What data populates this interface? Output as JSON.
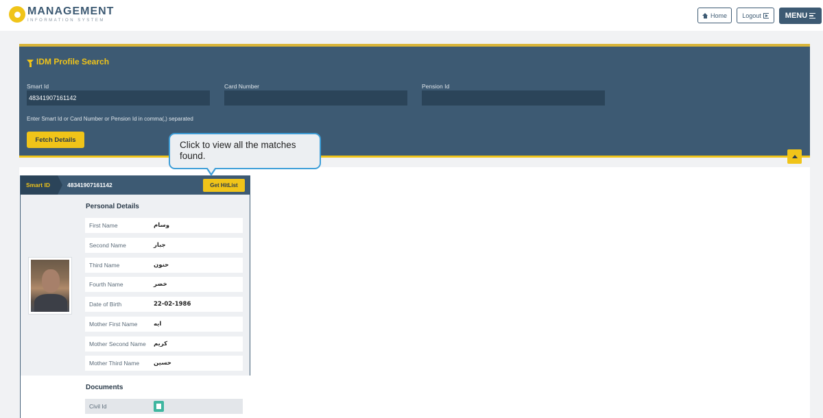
{
  "header": {
    "logo_title": "MANAGEMENT",
    "logo_subtitle": "INFORMATION SYSTEM",
    "home_label": "Home",
    "logout_label": "Logout",
    "menu_label": "MENU"
  },
  "search": {
    "title": "IDM Profile Search",
    "smart_id_label": "Smart Id",
    "smart_id_value": "48341907161142",
    "card_number_label": "Card Number",
    "card_number_value": "",
    "pension_id_label": "Pension Id",
    "pension_id_value": "",
    "hint": "Enter Smart Id or Card Number or Pension Id in comma(,) separated",
    "fetch_label": "Fetch Details"
  },
  "tooltip": {
    "text": "Click to view all the matches found."
  },
  "profile": {
    "smart_id_tag": "Smart ID",
    "smart_id_value": "48341907161142",
    "hitlist_label": "Get HitList",
    "personal_title": "Personal Details",
    "fields": [
      {
        "label": "First Name",
        "value": "وسام"
      },
      {
        "label": "Second Name",
        "value": "جبار"
      },
      {
        "label": "Third Name",
        "value": "حنون"
      },
      {
        "label": "Fourth Name",
        "value": "خضر"
      },
      {
        "label": "Date of Birth",
        "value": "22-02-1986"
      },
      {
        "label": "Mother First Name",
        "value": "ايه"
      },
      {
        "label": "Mother Second Name",
        "value": "كريم"
      },
      {
        "label": "Mother Third Name",
        "value": "حسين"
      }
    ],
    "documents_title": "Documents",
    "documents": [
      {
        "label": "Civil Id"
      }
    ]
  },
  "colors": {
    "primary": "#3d5a73",
    "accent": "#f0c419",
    "doc_icon": "#3fb6a0"
  }
}
